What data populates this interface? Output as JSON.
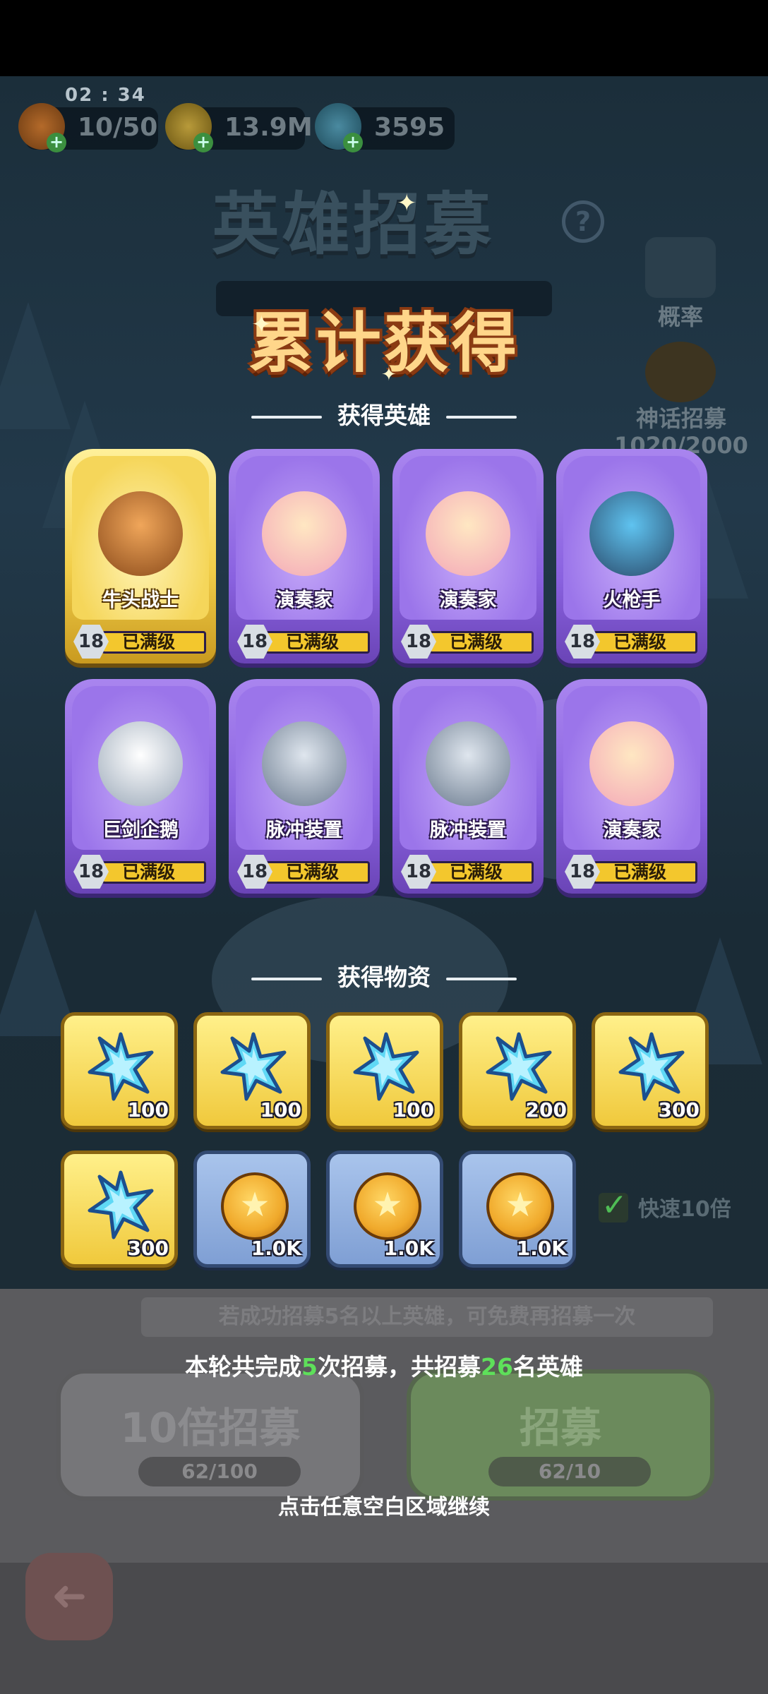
{
  "hud": {
    "time": "02 : 34",
    "stamina": "10/50",
    "gold": "13.9M",
    "gems": "3595"
  },
  "background": {
    "title": "英雄招募",
    "help": "?",
    "probability_label": "概率",
    "mythic_label": "神话招募",
    "mythic_progress": "1020/2000",
    "tip": "若成功招募5名以上英雄，可免费再招募一次",
    "ten_label": "10倍招募",
    "ten_cost": "62/100",
    "single_label": "招募",
    "single_cost": "62/10",
    "quick_label": "快速10倍"
  },
  "modal": {
    "title": "累计获得",
    "heroes_header": "获得英雄",
    "items_header": "获得物资",
    "summary_pre": "本轮共完成",
    "summary_rounds": "5",
    "summary_mid": "次招募，共招募",
    "summary_count": "26",
    "summary_post": "名英雄",
    "continue": "点击任意空白区域继续"
  },
  "heroes": [
    {
      "name": "牛头战士",
      "level": "18",
      "status": "已满级",
      "rarity": "gold",
      "icon": "minotaur-warrior-icon"
    },
    {
      "name": "演奏家",
      "level": "18",
      "status": "已满级",
      "rarity": "purple",
      "icon": "musician-icon"
    },
    {
      "name": "演奏家",
      "level": "18",
      "status": "已满级",
      "rarity": "purple",
      "icon": "musician-icon"
    },
    {
      "name": "火枪手",
      "level": "18",
      "status": "已满级",
      "rarity": "purple",
      "icon": "musketeer-icon"
    },
    {
      "name": "巨剑企鹅",
      "level": "18",
      "status": "已满级",
      "rarity": "purple",
      "icon": "sword-penguin-icon"
    },
    {
      "name": "脉冲装置",
      "level": "18",
      "status": "已满级",
      "rarity": "purple",
      "icon": "pulse-device-icon"
    },
    {
      "name": "脉冲装置",
      "level": "18",
      "status": "已满级",
      "rarity": "purple",
      "icon": "pulse-device-icon"
    },
    {
      "name": "演奏家",
      "level": "18",
      "status": "已满级",
      "rarity": "purple",
      "icon": "musician-icon"
    }
  ],
  "items": [
    {
      "type": "gem",
      "amount": "100"
    },
    {
      "type": "gem",
      "amount": "100"
    },
    {
      "type": "gem",
      "amount": "100"
    },
    {
      "type": "gem",
      "amount": "200"
    },
    {
      "type": "gem",
      "amount": "300"
    },
    {
      "type": "gem",
      "amount": "300"
    },
    {
      "type": "coin",
      "amount": "1.0K"
    },
    {
      "type": "coin",
      "amount": "1.0K"
    },
    {
      "type": "coin",
      "amount": "1.0K"
    }
  ],
  "colors": {
    "purple_card": "#8a62e0",
    "gold_card": "#f2cf4b",
    "highlight_green": "#5ee05a",
    "title_gold": "#ffd68a"
  }
}
